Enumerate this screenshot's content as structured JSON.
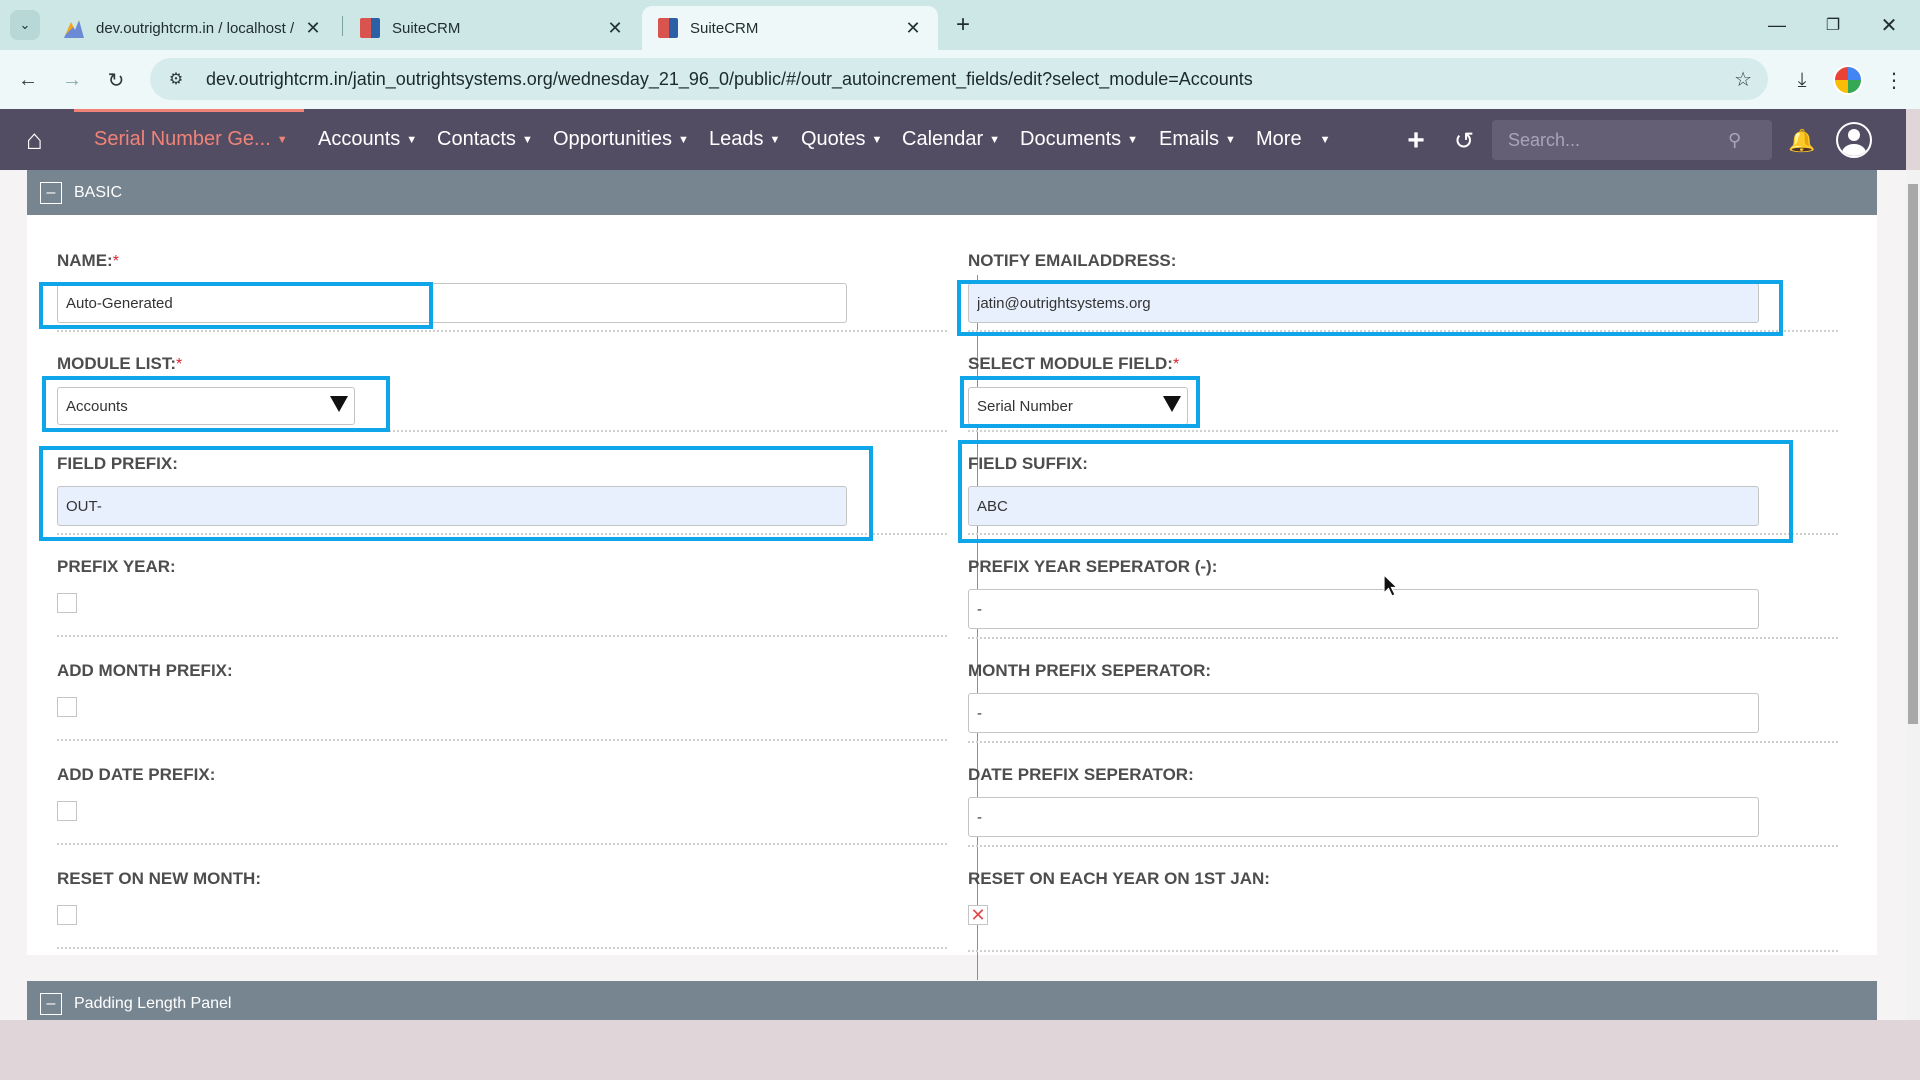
{
  "browser": {
    "tabs": [
      {
        "title": "dev.outrightcrm.in / localhost /",
        "close": "✕"
      },
      {
        "title": "SuiteCRM",
        "close": "✕"
      },
      {
        "title": "SuiteCRM",
        "close": "✕"
      }
    ],
    "new_tab": "+",
    "url": "dev.outrightcrm.in/jatin_outrightsystems.org/wednesday_21_96_0/public/#/outr_autoincrement_fields/edit?select_module=Accounts"
  },
  "crm_nav": {
    "items": [
      {
        "label": "Serial Number Ge..."
      },
      {
        "label": "Accounts"
      },
      {
        "label": "Contacts"
      },
      {
        "label": "Opportunities"
      },
      {
        "label": "Leads"
      },
      {
        "label": "Quotes"
      },
      {
        "label": "Calendar"
      },
      {
        "label": "Documents"
      },
      {
        "label": "Emails"
      },
      {
        "label": "More"
      }
    ],
    "search_placeholder": "Search..."
  },
  "panels": {
    "basic": {
      "title": "BASIC"
    },
    "padding": {
      "title": "Padding Length Panel"
    }
  },
  "form": {
    "name": {
      "label": "NAME:",
      "required": "*",
      "value": "Auto-Generated"
    },
    "notify_email": {
      "label": "NOTIFY EMAILADDRESS:",
      "value": "jatin@outrightsystems.org"
    },
    "module_list": {
      "label": "MODULE LIST:",
      "required": "*",
      "value": "Accounts"
    },
    "select_module_field": {
      "label": "SELECT MODULE FIELD:",
      "required": "*",
      "value": "Serial Number"
    },
    "field_prefix": {
      "label": "FIELD PREFIX:",
      "value": "OUT-"
    },
    "field_suffix": {
      "label": "FIELD SUFFIX:",
      "value": "ABC"
    },
    "prefix_year": {
      "label": "PREFIX YEAR:",
      "checked": false
    },
    "prefix_year_separator": {
      "label": "PREFIX YEAR SEPERATOR (-):",
      "value": "-"
    },
    "add_month_prefix": {
      "label": "ADD MONTH PREFIX:",
      "checked": false
    },
    "month_prefix_separator": {
      "label": "MONTH PREFIX SEPERATOR:",
      "value": "-"
    },
    "add_date_prefix": {
      "label": "ADD DATE PREFIX:",
      "checked": false
    },
    "date_prefix_separator": {
      "label": "DATE PREFIX SEPERATOR:",
      "value": "-"
    },
    "reset_new_month": {
      "label": "RESET ON NEW MONTH:",
      "checked": false
    },
    "reset_each_year": {
      "label": "RESET ON EACH YEAR ON 1ST JAN:",
      "checked": true,
      "mark": "✕"
    }
  },
  "colors": {
    "highlight": "#0ea5e9",
    "nav_bg": "#534d64",
    "nav_active": "#f08377",
    "panel_header": "#778591"
  }
}
